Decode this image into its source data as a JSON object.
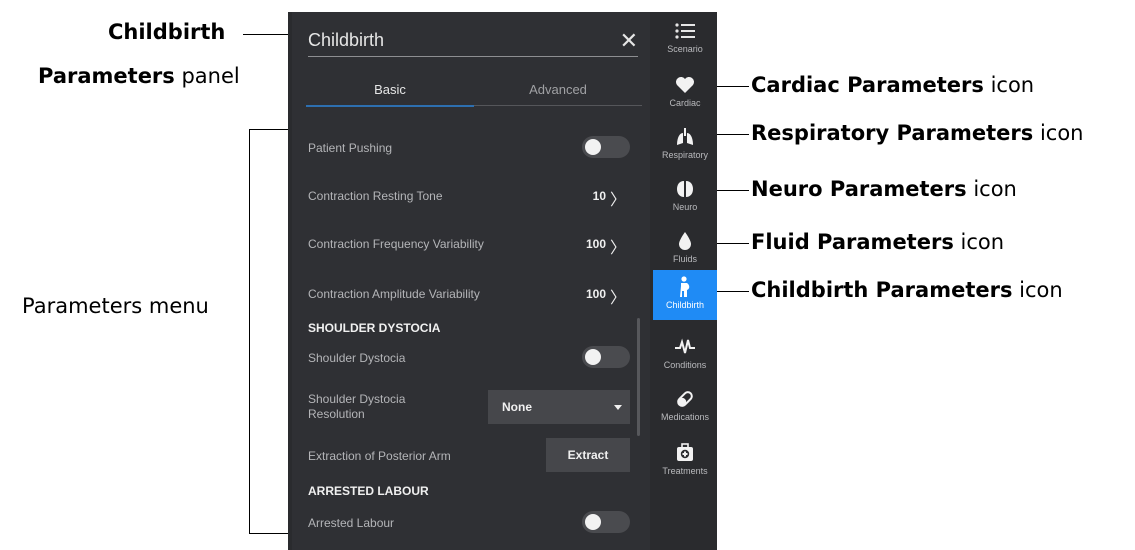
{
  "annotations": {
    "childbirth_panel_line1": "Childbirth",
    "childbirth_panel_line2_bold": "Parameters",
    "childbirth_panel_line2_rest": " panel",
    "parameters_menu": "Parameters menu",
    "icons": [
      {
        "bold": "Cardiac Parameters",
        "rest": " icon"
      },
      {
        "bold": "Respiratory Parameters",
        "rest": " icon"
      },
      {
        "bold": "Neuro Parameters",
        "rest": " icon"
      },
      {
        "bold": "Fluid Parameters",
        "rest": " icon"
      },
      {
        "bold": "Childbirth Parameters",
        "rest": " icon"
      }
    ]
  },
  "panel": {
    "title": "Childbirth",
    "close_glyph": "✕",
    "tabs": [
      {
        "label": "Basic",
        "active": true
      },
      {
        "label": "Advanced",
        "active": false
      }
    ],
    "params": {
      "patient_pushing": {
        "label": "Patient Pushing",
        "on": false
      },
      "contraction_resting_tone": {
        "label": "Contraction Resting Tone",
        "value": "10"
      },
      "contraction_frequency_variability": {
        "label": "Contraction Frequency Variability",
        "value": "100"
      },
      "contraction_amplitude_variability": {
        "label": "Contraction Amplitude Variability",
        "value": "100"
      },
      "shoulder_dystocia_section": "SHOULDER DYSTOCIA",
      "shoulder_dystocia": {
        "label": "Shoulder Dystocia",
        "on": false
      },
      "shoulder_dystocia_resolution": {
        "label_line1": "Shoulder Dystocia",
        "label_line2": "Resolution",
        "selected": "None"
      },
      "extraction_posterior_arm": {
        "label": "Extraction of Posterior Arm",
        "button": "Extract"
      },
      "arrested_labour_section": "ARRESTED LABOUR",
      "arrested_labour": {
        "label": "Arrested Labour",
        "on": false
      }
    },
    "chevron_glyph": "〉"
  },
  "rail": {
    "items": [
      {
        "label": "Scenario",
        "icon": "list-icon"
      },
      {
        "label": "Cardiac",
        "icon": "heart-icon"
      },
      {
        "label": "Respiratory",
        "icon": "lungs-icon"
      },
      {
        "label": "Neuro",
        "icon": "brain-icon"
      },
      {
        "label": "Fluids",
        "icon": "droplet-icon"
      },
      {
        "label": "Childbirth",
        "icon": "pregnant-person-icon",
        "active": true
      },
      {
        "label": "Conditions",
        "icon": "pulse-icon"
      },
      {
        "label": "Medications",
        "icon": "pill-icon"
      },
      {
        "label": "Treatments",
        "icon": "first-aid-kit-icon"
      }
    ],
    "active_color": "#1f8bf5"
  }
}
